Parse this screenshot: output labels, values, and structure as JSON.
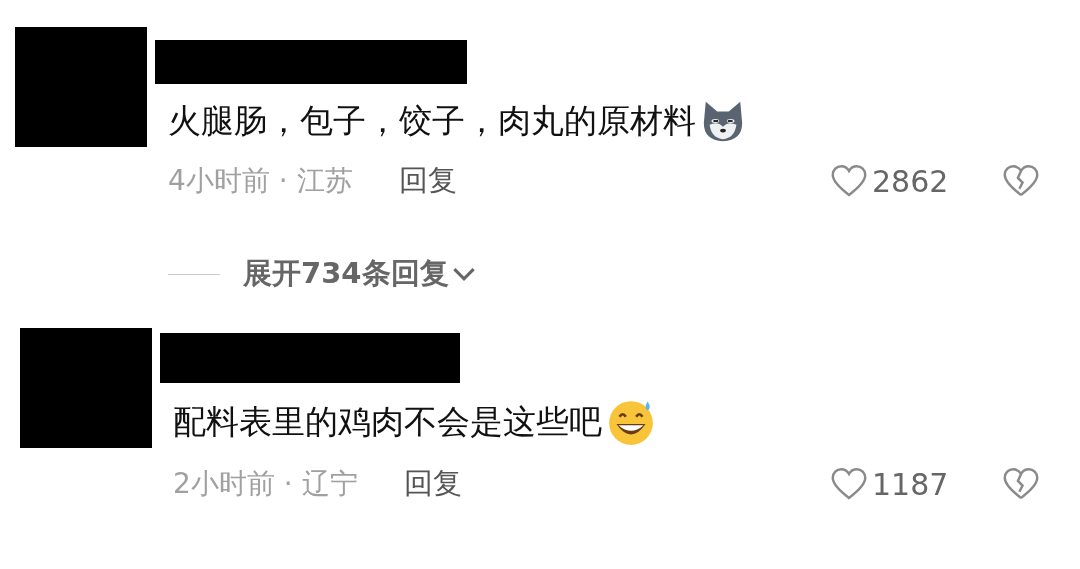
{
  "comments": [
    {
      "text": "火腿肠，包子，饺子，肉丸的原材料",
      "time": "4小时前 · 江苏",
      "reply": "回复",
      "likes": "2862",
      "expand": "展开734条回复"
    },
    {
      "text": "配料表里的鸡肉不会是这些吧",
      "time": "2小时前 · 辽宁",
      "reply": "回复",
      "likes": "1187"
    }
  ]
}
